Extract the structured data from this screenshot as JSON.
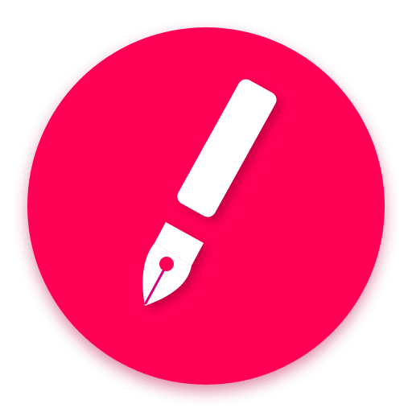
{
  "icon": {
    "name": "fountain-pen-app-icon",
    "glyph": "fountain-pen-icon",
    "colors": {
      "background": "#ffffff",
      "circle": "#ff0055",
      "pen": "#ffffff",
      "slit": "#d6007a",
      "shadow": "#b8003f"
    }
  }
}
